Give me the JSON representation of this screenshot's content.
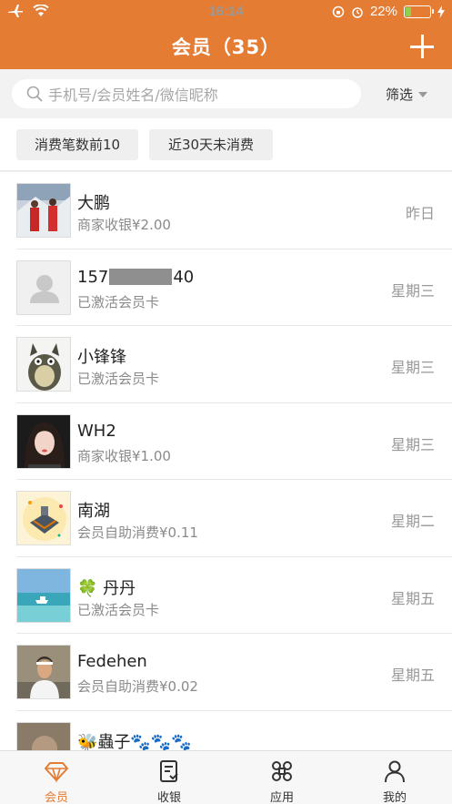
{
  "status_bar": {
    "time": "16:14",
    "battery": "22%",
    "battery_level": 0.22
  },
  "nav": {
    "title": "会员（35）"
  },
  "search": {
    "placeholder": "手机号/会员姓名/微信昵称",
    "filter_label": "筛选"
  },
  "tags": [
    "消费笔数前10",
    "近30天未消费"
  ],
  "members": [
    {
      "name": "大鹏",
      "sub": "商家收银¥2.00",
      "time": "昨日"
    },
    {
      "name_prefix": "157",
      "name_suffix": "40",
      "sub": "已激活会员卡",
      "time": "星期三"
    },
    {
      "name": "小锋锋",
      "sub": "已激活会员卡",
      "time": "星期三"
    },
    {
      "name": "WH2",
      "sub": "商家收银¥1.00",
      "time": "星期三"
    },
    {
      "name": "南湖",
      "sub": "会员自助消费¥0.11",
      "time": "星期二"
    },
    {
      "name": "🍀 丹丹",
      "sub": "已激活会员卡",
      "time": "星期五"
    },
    {
      "name": "Fedehen",
      "sub": "会员自助消费¥0.02",
      "time": "星期五"
    },
    {
      "name": "🐝蟲子🐾🐾🐾",
      "sub": "",
      "time": ""
    }
  ],
  "tab_bar": {
    "items": [
      "会员",
      "收银",
      "应用",
      "我的"
    ],
    "active": 0
  },
  "colors": {
    "accent": "#e47c34",
    "battery": "#8fd14f"
  }
}
